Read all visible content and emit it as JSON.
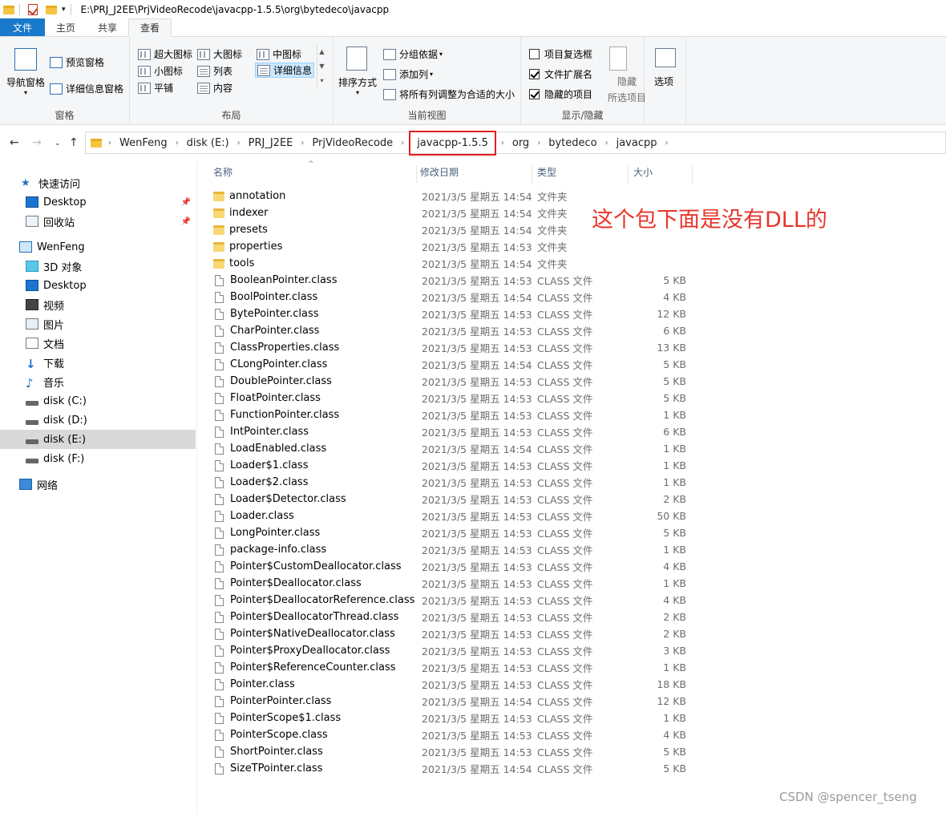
{
  "titlebar": {
    "path": "E:\\PRJ_J2EE\\PrjVideoRecode\\javacpp-1.5.5\\org\\bytedeco\\javacpp"
  },
  "tabs": [
    "文件",
    "主页",
    "共享",
    "查看"
  ],
  "ribbon": {
    "pane": {
      "nav_pane": "导航窗格",
      "preview_pane": "预览窗格",
      "details_pane": "详细信息窗格",
      "label": "窗格"
    },
    "layout": {
      "items": [
        "超大图标",
        "大图标",
        "中图标",
        "小图标",
        "列表",
        "详细信息",
        "平铺",
        "内容"
      ],
      "label": "布局"
    },
    "current_view": {
      "sort": "排序方式",
      "group_by": "分组依据",
      "add_columns": "添加列",
      "fit_columns": "将所有列调整为合适的大小",
      "label": "当前视图"
    },
    "show_hide": {
      "item_checkboxes": "项目复选框",
      "file_extensions": "文件扩展名",
      "hidden_items": "隐藏的项目",
      "hide_selected_1": "隐藏",
      "hide_selected_2": "所选项目",
      "label": "显示/隐藏"
    },
    "options": "选项"
  },
  "address": {
    "crumbs": [
      "WenFeng",
      "disk (E:)",
      "PRJ_J2EE",
      "PrjVideoRecode",
      "javacpp-1.5.5",
      "org",
      "bytedeco",
      "javacpp"
    ]
  },
  "sidebar": {
    "items": [
      {
        "label": "快速访问",
        "icon": "star-icon"
      },
      {
        "label": "Desktop",
        "icon": "desktop-icon"
      },
      {
        "label": "回收站",
        "icon": "recycle-bin-icon"
      },
      {
        "label": "WenFeng",
        "icon": "computer-icon"
      },
      {
        "label": "3D 对象",
        "icon": "3d-objects-icon"
      },
      {
        "label": "Desktop",
        "icon": "desktop-icon"
      },
      {
        "label": "视频",
        "icon": "video-icon"
      },
      {
        "label": "图片",
        "icon": "pictures-icon"
      },
      {
        "label": "文档",
        "icon": "documents-icon"
      },
      {
        "label": "下载",
        "icon": "download-icon"
      },
      {
        "label": "音乐",
        "icon": "music-icon"
      },
      {
        "label": "disk (C:)",
        "icon": "drive-icon"
      },
      {
        "label": "disk (D:)",
        "icon": "drive-icon"
      },
      {
        "label": "disk (E:)",
        "icon": "drive-icon"
      },
      {
        "label": "disk (F:)",
        "icon": "drive-icon"
      },
      {
        "label": "网络",
        "icon": "network-icon"
      }
    ]
  },
  "columns": {
    "name": "名称",
    "date": "修改日期",
    "type": "类型",
    "size": "大小"
  },
  "files": [
    {
      "name": "annotation",
      "date": "2021/3/5 星期五 14:54",
      "type": "文件夹",
      "size": ""
    },
    {
      "name": "indexer",
      "date": "2021/3/5 星期五 14:54",
      "type": "文件夹",
      "size": ""
    },
    {
      "name": "presets",
      "date": "2021/3/5 星期五 14:54",
      "type": "文件夹",
      "size": ""
    },
    {
      "name": "properties",
      "date": "2021/3/5 星期五 14:53",
      "type": "文件夹",
      "size": ""
    },
    {
      "name": "tools",
      "date": "2021/3/5 星期五 14:54",
      "type": "文件夹",
      "size": ""
    },
    {
      "name": "BooleanPointer.class",
      "date": "2021/3/5 星期五 14:53",
      "type": "CLASS 文件",
      "size": "5 KB"
    },
    {
      "name": "BoolPointer.class",
      "date": "2021/3/5 星期五 14:54",
      "type": "CLASS 文件",
      "size": "4 KB"
    },
    {
      "name": "BytePointer.class",
      "date": "2021/3/5 星期五 14:53",
      "type": "CLASS 文件",
      "size": "12 KB"
    },
    {
      "name": "CharPointer.class",
      "date": "2021/3/5 星期五 14:53",
      "type": "CLASS 文件",
      "size": "6 KB"
    },
    {
      "name": "ClassProperties.class",
      "date": "2021/3/5 星期五 14:53",
      "type": "CLASS 文件",
      "size": "13 KB"
    },
    {
      "name": "CLongPointer.class",
      "date": "2021/3/5 星期五 14:54",
      "type": "CLASS 文件",
      "size": "5 KB"
    },
    {
      "name": "DoublePointer.class",
      "date": "2021/3/5 星期五 14:53",
      "type": "CLASS 文件",
      "size": "5 KB"
    },
    {
      "name": "FloatPointer.class",
      "date": "2021/3/5 星期五 14:53",
      "type": "CLASS 文件",
      "size": "5 KB"
    },
    {
      "name": "FunctionPointer.class",
      "date": "2021/3/5 星期五 14:53",
      "type": "CLASS 文件",
      "size": "1 KB"
    },
    {
      "name": "IntPointer.class",
      "date": "2021/3/5 星期五 14:53",
      "type": "CLASS 文件",
      "size": "6 KB"
    },
    {
      "name": "LoadEnabled.class",
      "date": "2021/3/5 星期五 14:54",
      "type": "CLASS 文件",
      "size": "1 KB"
    },
    {
      "name": "Loader$1.class",
      "date": "2021/3/5 星期五 14:53",
      "type": "CLASS 文件",
      "size": "1 KB"
    },
    {
      "name": "Loader$2.class",
      "date": "2021/3/5 星期五 14:53",
      "type": "CLASS 文件",
      "size": "1 KB"
    },
    {
      "name": "Loader$Detector.class",
      "date": "2021/3/5 星期五 14:53",
      "type": "CLASS 文件",
      "size": "2 KB"
    },
    {
      "name": "Loader.class",
      "date": "2021/3/5 星期五 14:53",
      "type": "CLASS 文件",
      "size": "50 KB"
    },
    {
      "name": "LongPointer.class",
      "date": "2021/3/5 星期五 14:53",
      "type": "CLASS 文件",
      "size": "5 KB"
    },
    {
      "name": "package-info.class",
      "date": "2021/3/5 星期五 14:53",
      "type": "CLASS 文件",
      "size": "1 KB"
    },
    {
      "name": "Pointer$CustomDeallocator.class",
      "date": "2021/3/5 星期五 14:53",
      "type": "CLASS 文件",
      "size": "4 KB"
    },
    {
      "name": "Pointer$Deallocator.class",
      "date": "2021/3/5 星期五 14:53",
      "type": "CLASS 文件",
      "size": "1 KB"
    },
    {
      "name": "Pointer$DeallocatorReference.class",
      "date": "2021/3/5 星期五 14:53",
      "type": "CLASS 文件",
      "size": "4 KB"
    },
    {
      "name": "Pointer$DeallocatorThread.class",
      "date": "2021/3/5 星期五 14:53",
      "type": "CLASS 文件",
      "size": "2 KB"
    },
    {
      "name": "Pointer$NativeDeallocator.class",
      "date": "2021/3/5 星期五 14:53",
      "type": "CLASS 文件",
      "size": "2 KB"
    },
    {
      "name": "Pointer$ProxyDeallocator.class",
      "date": "2021/3/5 星期五 14:53",
      "type": "CLASS 文件",
      "size": "3 KB"
    },
    {
      "name": "Pointer$ReferenceCounter.class",
      "date": "2021/3/5 星期五 14:53",
      "type": "CLASS 文件",
      "size": "1 KB"
    },
    {
      "name": "Pointer.class",
      "date": "2021/3/5 星期五 14:53",
      "type": "CLASS 文件",
      "size": "18 KB"
    },
    {
      "name": "PointerPointer.class",
      "date": "2021/3/5 星期五 14:54",
      "type": "CLASS 文件",
      "size": "12 KB"
    },
    {
      "name": "PointerScope$1.class",
      "date": "2021/3/5 星期五 14:53",
      "type": "CLASS 文件",
      "size": "1 KB"
    },
    {
      "name": "PointerScope.class",
      "date": "2021/3/5 星期五 14:53",
      "type": "CLASS 文件",
      "size": "4 KB"
    },
    {
      "name": "ShortPointer.class",
      "date": "2021/3/5 星期五 14:53",
      "type": "CLASS 文件",
      "size": "5 KB"
    },
    {
      "name": "SizeTPointer.class",
      "date": "2021/3/5 星期五 14:54",
      "type": "CLASS 文件",
      "size": "5 KB"
    }
  ],
  "annotation": "这个包下面是没有DLL的",
  "watermark": "CSDN @spencer_tseng",
  "colors": {
    "accent": "#1979ca",
    "highlight_box": "#e02020",
    "annotation": "#e8362a",
    "selected_bg": "#d9d9d9"
  }
}
